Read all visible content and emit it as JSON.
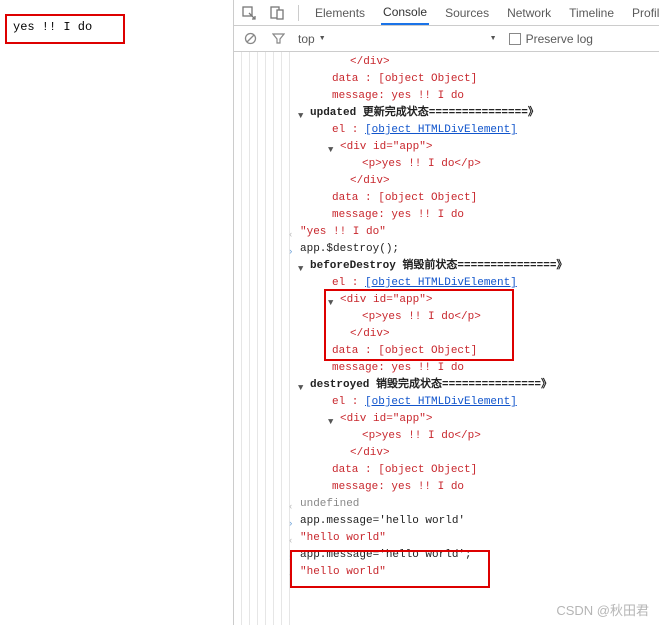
{
  "page": {
    "app_text": "yes !! I do"
  },
  "tabs": {
    "elements": "Elements",
    "console": "Console",
    "sources": "Sources",
    "network": "Network",
    "timeline": "Timeline",
    "profiles": "Profiles"
  },
  "toolbar": {
    "context": "top",
    "preserve_log": "Preserve log"
  },
  "logs": {
    "close_div": "</div>",
    "data_label": "data   :",
    "data_value": "[object Object]",
    "message_label": "message:",
    "message_value": "yes !! I do",
    "updated_header": "updated  更新完成状态===============》",
    "el_label": "el     :",
    "el_value": "[object HTMLDivElement]",
    "div_open": "<div id=\"app\">",
    "p_line": "<p>yes !! I do</p>",
    "yes_quoted": "\"yes !! I do\"",
    "destroy_call": "app.$destroy();",
    "beforeDestroy_header": "beforeDestroy  销毁前状态===============》",
    "destroyed_header": "destroyed  销毁完成状态===============》",
    "undefined": "undefined",
    "set_hello": "app.message='hello world'",
    "hello_quoted": "\"hello world\"",
    "set_hello2": "app.message='hello world';"
  },
  "watermark": "CSDN @秋田君"
}
